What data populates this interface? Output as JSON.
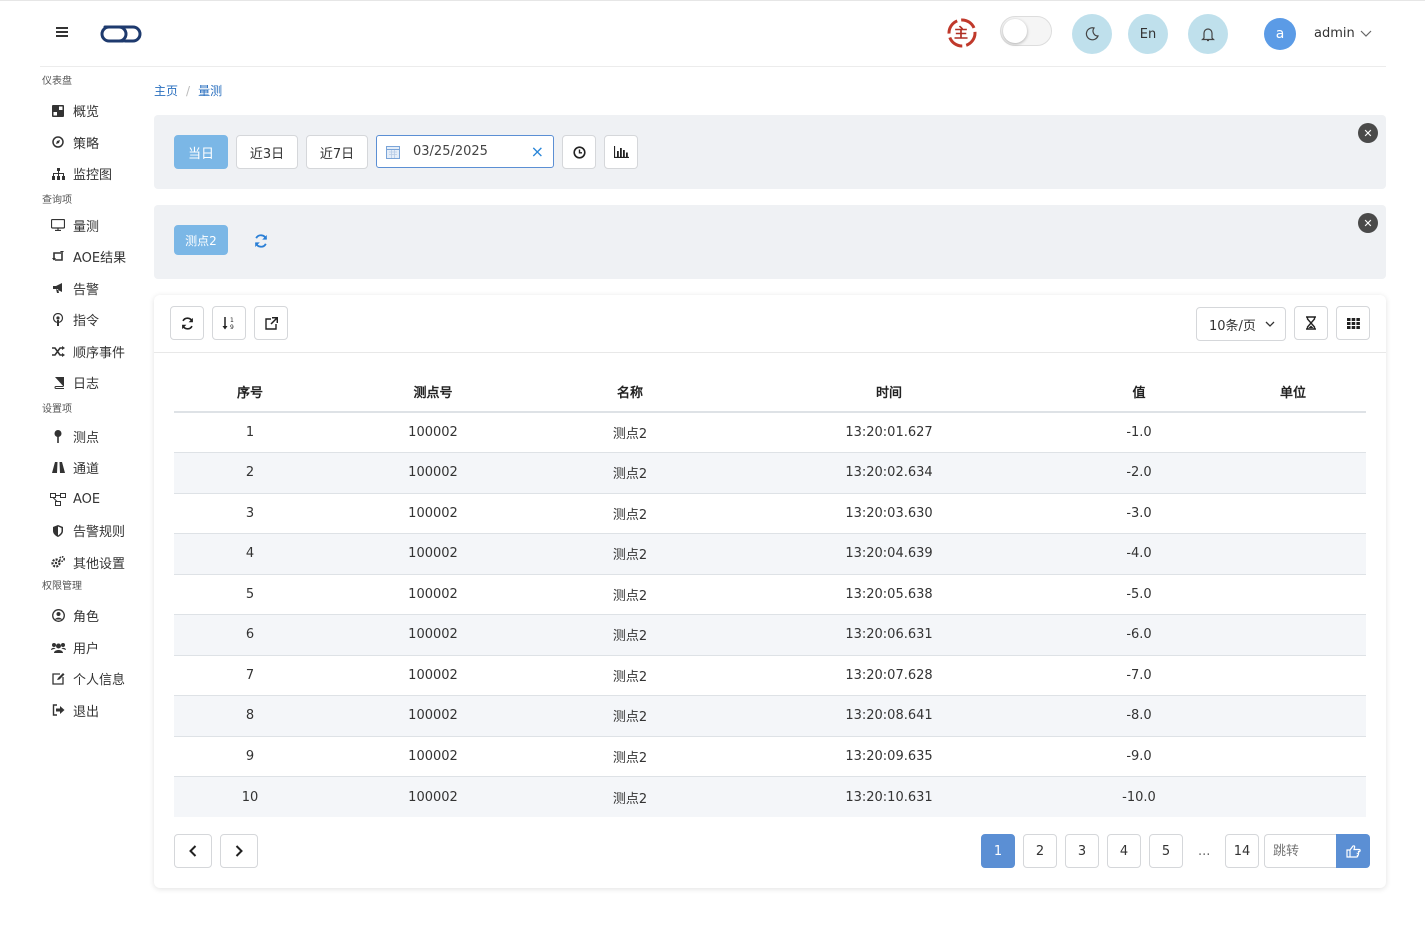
{
  "header": {
    "zhu_badge": "主",
    "lang_label": "En",
    "avatar_letter": "a",
    "username": "admin"
  },
  "sidebar": {
    "sections": [
      {
        "title": "仪表盘",
        "items": [
          {
            "label": "概览",
            "icon": "dashboard-icon"
          },
          {
            "label": "策略",
            "icon": "compass-icon"
          },
          {
            "label": "监控图",
            "icon": "sitemap-icon"
          }
        ]
      },
      {
        "title": "查询项",
        "items": [
          {
            "label": "量测",
            "icon": "monitor-icon"
          },
          {
            "label": "AOE结果",
            "icon": "retweet-icon"
          },
          {
            "label": "告警",
            "icon": "bullhorn-icon"
          },
          {
            "label": "指令",
            "icon": "podcast-icon"
          },
          {
            "label": "顺序事件",
            "icon": "random-icon"
          },
          {
            "label": "日志",
            "icon": "book-icon"
          }
        ]
      },
      {
        "title": "设置项",
        "items": [
          {
            "label": "测点",
            "icon": "map-pin-icon"
          },
          {
            "label": "通道",
            "icon": "road-icon"
          },
          {
            "label": "AOE",
            "icon": "project-diagram-icon"
          },
          {
            "label": "告警规则",
            "icon": "shield-icon"
          },
          {
            "label": "其他设置",
            "icon": "cogs-icon"
          }
        ]
      },
      {
        "title": "权限管理",
        "items": [
          {
            "label": "角色",
            "icon": "user-circle-icon"
          },
          {
            "label": "用户",
            "icon": "users-icon"
          },
          {
            "label": "个人信息",
            "icon": "edit-icon"
          },
          {
            "label": "退出",
            "icon": "sign-out-icon"
          }
        ]
      }
    ]
  },
  "breadcrumb": {
    "home": "主页",
    "sep": "/",
    "current": "量测"
  },
  "filters": {
    "today": "当日",
    "last3": "近3日",
    "last7": "近7日",
    "date": "03/25/2025",
    "clear": "×"
  },
  "points": {
    "selected": "测点2"
  },
  "toolbar": {
    "page_size": "10条/页"
  },
  "table": {
    "columns": [
      "序号",
      "测点号",
      "名称",
      "时间",
      "值",
      "单位"
    ],
    "rows": [
      [
        "1",
        "100002",
        "测点2",
        "13:20:01.627",
        "-1.0",
        ""
      ],
      [
        "2",
        "100002",
        "测点2",
        "13:20:02.634",
        "-2.0",
        ""
      ],
      [
        "3",
        "100002",
        "测点2",
        "13:20:03.630",
        "-3.0",
        ""
      ],
      [
        "4",
        "100002",
        "测点2",
        "13:20:04.639",
        "-4.0",
        ""
      ],
      [
        "5",
        "100002",
        "测点2",
        "13:20:05.638",
        "-5.0",
        ""
      ],
      [
        "6",
        "100002",
        "测点2",
        "13:20:06.631",
        "-6.0",
        ""
      ],
      [
        "7",
        "100002",
        "测点2",
        "13:20:07.628",
        "-7.0",
        ""
      ],
      [
        "8",
        "100002",
        "测点2",
        "13:20:08.641",
        "-8.0",
        ""
      ],
      [
        "9",
        "100002",
        "测点2",
        "13:20:09.635",
        "-9.0",
        ""
      ],
      [
        "10",
        "100002",
        "测点2",
        "13:20:10.631",
        "-10.0",
        ""
      ]
    ]
  },
  "pagination": {
    "pages": [
      "1",
      "2",
      "3",
      "4",
      "5"
    ],
    "ellipsis": "...",
    "last": "14",
    "jump_placeholder": "跳转"
  },
  "colors": {
    "accent": "#5b8fd4",
    "active_btn": "#7bb7e6",
    "panel_bg": "#eff1f4",
    "circle_btn": "#bfe0ec"
  }
}
